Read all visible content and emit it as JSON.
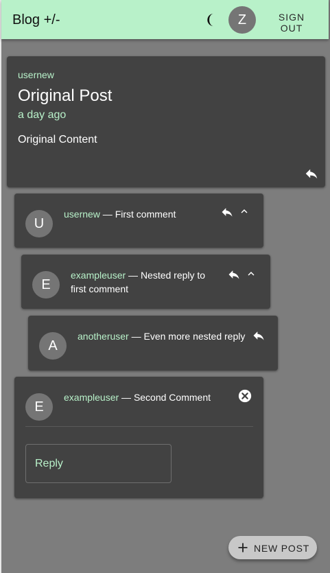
{
  "app": {
    "title": "Blog +/-",
    "user_initial": "Z",
    "sign_out_label": "SIGN OUT",
    "theme_icon": "moon-icon"
  },
  "colors": {
    "appbar": "#b8f1c9",
    "background": "#7d7d7d",
    "card": "#424242",
    "author_accent": "#b8f1c9"
  },
  "post": {
    "author": "usernew",
    "title": "Original Post",
    "time": "a day ago",
    "content": "Original Content"
  },
  "comments": [
    {
      "initial": "U",
      "author": "usernew",
      "separator": " — ",
      "text": "First comment"
    },
    {
      "initial": "E",
      "author": "exampleuser",
      "separator": " — ",
      "text": "Nested reply to first comment"
    },
    {
      "initial": "A",
      "author": "anotheruser",
      "separator": " — ",
      "text": "Even more nested reply"
    },
    {
      "initial": "E",
      "author": "exampleuser",
      "separator": " — ",
      "text": "Second Comment"
    }
  ],
  "reply_form": {
    "label": "Reply"
  },
  "fab": {
    "label": "NEW POST"
  }
}
